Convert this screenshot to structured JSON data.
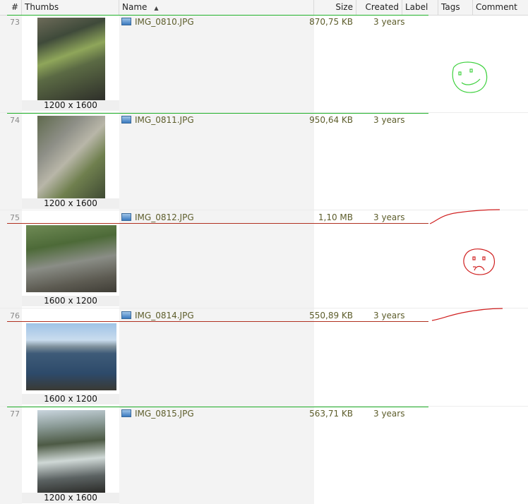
{
  "columns": {
    "num": "#",
    "thumbs": "Thumbs",
    "name": "Name",
    "size": "Size",
    "created": "Created",
    "label": "Label",
    "tags": "Tags",
    "comment": "Comment"
  },
  "sort_icon": "sort-ascending-icon",
  "rows": [
    {
      "num": "73",
      "name": "IMG_0810.JPG",
      "size": "870,75 KB",
      "created": "3 years",
      "dims": "1200 x 1600",
      "label_color": "#22b22b"
    },
    {
      "num": "74",
      "name": "IMG_0811.JPG",
      "size": "950,64 KB",
      "created": "3 years",
      "dims": "1200 x 1600",
      "label_color": "#22b22b"
    },
    {
      "num": "75",
      "name": "IMG_0812.JPG",
      "size": "1,10 MB",
      "created": "3 years",
      "dims": "1600 x 1200",
      "label_color": "#b03020"
    },
    {
      "num": "76",
      "name": "IMG_0814.JPG",
      "size": "550,89 KB",
      "created": "3 years",
      "dims": "1600 x 1200",
      "label_color": "#b03020"
    },
    {
      "num": "77",
      "name": "IMG_0815.JPG",
      "size": "563,71 KB",
      "created": "3 years",
      "dims": "1200 x 1600",
      "label_color": "#22b22b"
    }
  ],
  "annotations": {
    "smiley_color": "#3fd13f",
    "frown_color": "#d02020",
    "stroke_color": "#d02020"
  }
}
